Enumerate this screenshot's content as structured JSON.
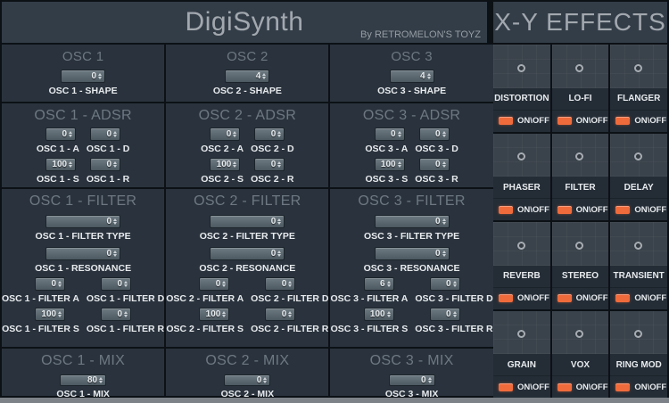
{
  "header": {
    "title": "DigiSynth",
    "byline": "By RETROMELON'S TOYZ"
  },
  "effects": {
    "title": "X-Y EFFECTS",
    "toggle_label": "ON\\OFF",
    "items": [
      "DISTORTION",
      "LO-FI",
      "FLANGER",
      "PHASER",
      "FILTER",
      "DELAY",
      "REVERB",
      "STEREO",
      "TRANSIENT",
      "GRAIN",
      "VOX",
      "RING MOD"
    ]
  },
  "oscillators": [
    {
      "title": "OSC 1",
      "shape_value": "0",
      "shape_label": "OSC 1 - SHAPE",
      "adsr_title": "OSC 1 - ADSR",
      "a_value": "0",
      "a_label": "OSC 1 - A",
      "d_value": "0",
      "d_label": "OSC 1 - D",
      "s_value": "100",
      "s_label": "OSC 1 - S",
      "r_value": "0",
      "r_label": "OSC 1 - R",
      "filter_title": "OSC 1 - FILTER",
      "filter_type_value": "0",
      "filter_type_label": "OSC 1 - FILTER TYPE",
      "resonance_value": "0",
      "resonance_label": "OSC 1 - RESONANCE",
      "fa_value": "0",
      "fa_label": "OSC 1 - FILTER A",
      "fd_value": "0",
      "fd_label": "OSC 1 - FILTER D",
      "fs_value": "100",
      "fs_label": "OSC 1 - FILTER S",
      "fr_value": "0",
      "fr_label": "OSC 1 - FILTER R",
      "mix_title": "OSC 1 - MIX",
      "mix_value": "80",
      "mix_label": "OSC 1 - MIX"
    },
    {
      "title": "OSC 2",
      "shape_value": "4",
      "shape_label": "OSC 2 - SHAPE",
      "adsr_title": "OSC 2 - ADSR",
      "a_value": "0",
      "a_label": "OSC 2 - A",
      "d_value": "0",
      "d_label": "OSC 2 - D",
      "s_value": "100",
      "s_label": "OSC 2 - S",
      "r_value": "0",
      "r_label": "OSC 2 - R",
      "filter_title": "OSC 2 - FILTER",
      "filter_type_value": "0",
      "filter_type_label": "OSC 2 - FILTER TYPE",
      "resonance_value": "0",
      "resonance_label": "OSC 2 - RESONANCE",
      "fa_value": "0",
      "fa_label": "OSC 2 - FILTER A",
      "fd_value": "0",
      "fd_label": "OSC 2 - FILTER D",
      "fs_value": "100",
      "fs_label": "OSC 2 - FILTER S",
      "fr_value": "0",
      "fr_label": "OSC 2 - FILTER R",
      "mix_title": "OSC 2 - MIX",
      "mix_value": "0",
      "mix_label": "OSC 2 - MIX"
    },
    {
      "title": "OSC 3",
      "shape_value": "4",
      "shape_label": "OSC 3 - SHAPE",
      "adsr_title": "OSC 3 - ADSR",
      "a_value": "0",
      "a_label": "OSC 3 - A",
      "d_value": "0",
      "d_label": "OSC 3 - D",
      "s_value": "100",
      "s_label": "OSC 3 - S",
      "r_value": "0",
      "r_label": "OSC 3 - R",
      "filter_title": "OSC 3 - FILTER",
      "filter_type_value": "0",
      "filter_type_label": "OSC 3 - FILTER TYPE",
      "resonance_value": "0",
      "resonance_label": "OSC 3 - RESONANCE",
      "fa_value": "6",
      "fa_label": "OSC 3 - FILTER A",
      "fd_value": "0",
      "fd_label": "OSC 3 - FILTER D",
      "fs_value": "100",
      "fs_label": "OSC 3 - FILTER S",
      "fr_value": "0",
      "fr_label": "OSC 3 - FILTER R",
      "mix_title": "OSC 3 - MIX",
      "mix_value": "0",
      "mix_label": "OSC 3 - MIX"
    }
  ],
  "colors": {
    "accent_orange": "#ef6b3c",
    "panel_bg": "#2a333d",
    "header_bg": "#333d48",
    "pad_bg": "#3a424b",
    "text_light": "#e8ebee",
    "text_muted": "#6d7883",
    "border": "#0c1116"
  }
}
